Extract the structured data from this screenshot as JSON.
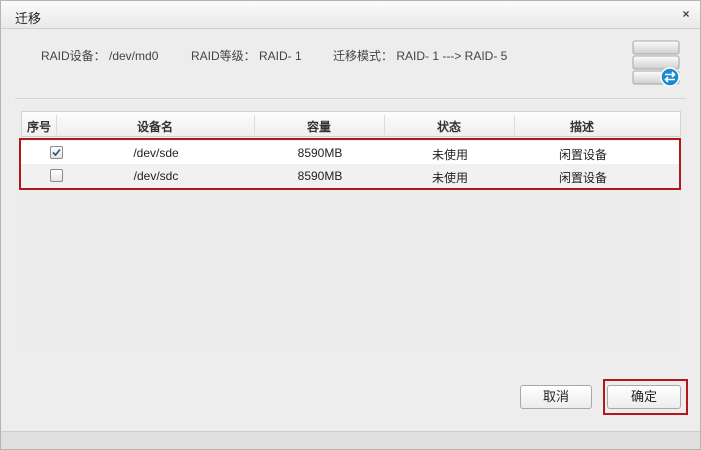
{
  "dialog": {
    "title": "迁移",
    "close_glyph": "×"
  },
  "info": {
    "device": "RAID设备： /dev/md0",
    "level": "RAID等级： RAID- 1",
    "mode": "迁移模式： RAID- 1 ---> RAID- 5"
  },
  "icons": {
    "header_icon": "storage-migrate-icon",
    "close": "close-icon",
    "checkbox_check": "check-icon"
  },
  "colors": {
    "highlight_border": "#b0181c",
    "accent_blue": "#1a8ad0"
  },
  "table": {
    "headers": [
      "序号",
      "设备名",
      "容量",
      "状态",
      "描述"
    ],
    "rows": [
      {
        "checked": true,
        "device": "/dev/sde",
        "capacity": "8590MB",
        "status": "未使用",
        "desc": "闲置设备"
      },
      {
        "checked": false,
        "device": "/dev/sdc",
        "capacity": "8590MB",
        "status": "未使用",
        "desc": "闲置设备"
      }
    ]
  },
  "buttons": {
    "cancel": "取消",
    "ok": "确定"
  }
}
